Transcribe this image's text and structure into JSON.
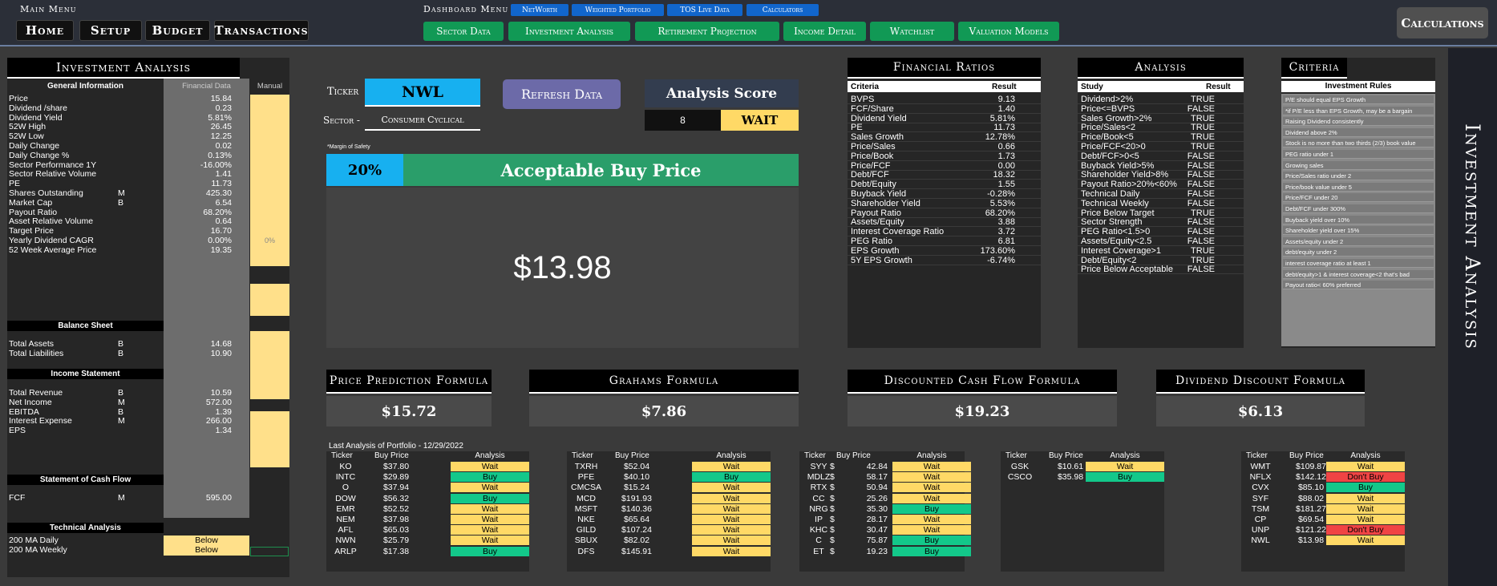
{
  "main_menu": {
    "title": "Main Menu",
    "items": [
      "Home",
      "Setup",
      "Budget",
      "Transactions"
    ]
  },
  "dashboard_menu": {
    "title": "Dashboard Menu",
    "top_items": [
      "NetWorth",
      "Weighted Portfolio",
      "TOS Live Data",
      "Calculators"
    ],
    "bottom_items": [
      "Sector Data",
      "Investment Analysis",
      "Retirement Projection",
      "Income Detail",
      "Watchlist",
      "Valuation Models"
    ]
  },
  "calculations_button": "Calculations",
  "side_title": "Investment Analysis",
  "info_panel": {
    "title": "Investment Analysis",
    "col_general": "General Information",
    "col_financial": "Financial Data",
    "col_manual": "Manual",
    "general": [
      {
        "label": "Price",
        "unit": "",
        "value": "15.84",
        "manual": ""
      },
      {
        "label": "Dividend /share",
        "unit": "",
        "value": "0.23",
        "manual": ""
      },
      {
        "label": "Dividend Yield",
        "unit": "",
        "value": "5.81%",
        "manual": ""
      },
      {
        "label": "52W High",
        "unit": "",
        "value": "26.45",
        "manual": ""
      },
      {
        "label": "52W Low",
        "unit": "",
        "value": "12.25",
        "manual": ""
      },
      {
        "label": "Daily Change",
        "unit": "",
        "value": "0.02",
        "manual": ""
      },
      {
        "label": "Daily Change %",
        "unit": "",
        "value": "0.13%",
        "manual": ""
      },
      {
        "label": "Sector Performance 1Y",
        "unit": "",
        "value": "-16.00%",
        "manual": ""
      },
      {
        "label": "Sector Relative Volume",
        "unit": "",
        "value": "1.41",
        "manual": ""
      },
      {
        "label": "PE",
        "unit": "",
        "value": "11.73",
        "manual": ""
      },
      {
        "label": "Shares Outstanding",
        "unit": "M",
        "value": "425.30",
        "manual": ""
      },
      {
        "label": "Market Cap",
        "unit": "B",
        "value": "6.54",
        "manual": ""
      },
      {
        "label": "Payout Ratio",
        "unit": "",
        "value": "68.20%",
        "manual": ""
      },
      {
        "label": "Asset Relative Volume",
        "unit": "",
        "value": "0.64",
        "manual": ""
      },
      {
        "label": "Target Price",
        "unit": "",
        "value": "16.70",
        "manual": ""
      },
      {
        "label": "Yearly Dividend CAGR",
        "unit": "",
        "value": "0.00%",
        "manual": "0%"
      },
      {
        "label": "52 Week Average Price",
        "unit": "",
        "value": "19.35",
        "manual": ""
      }
    ],
    "balance_title": "Balance Sheet",
    "balance": [
      {
        "label": "Total Assets",
        "unit": "B",
        "value": "14.68"
      },
      {
        "label": "Total Liabilities",
        "unit": "B",
        "value": "10.90"
      }
    ],
    "income_title": "Income Statement",
    "income": [
      {
        "label": "Total Revenue",
        "unit": "B",
        "value": "10.59"
      },
      {
        "label": "Net Income",
        "unit": "M",
        "value": "572.00"
      },
      {
        "label": "EBITDA",
        "unit": "B",
        "value": "1.39"
      },
      {
        "label": "Interest Expense",
        "unit": "M",
        "value": "266.00"
      },
      {
        "label": "EPS",
        "unit": "",
        "value": "1.34"
      }
    ],
    "cashflow_title": "Statement of Cash Flow",
    "cashflow": [
      {
        "label": "FCF",
        "unit": "M",
        "value": "595.00"
      }
    ],
    "technical_title": "Technical Analysis",
    "technical": [
      {
        "label": "200 MA Daily",
        "value": "Below"
      },
      {
        "label": "200 MA Weekly",
        "value": "Below"
      }
    ]
  },
  "ticker": {
    "label": "Ticker",
    "value": "NWL"
  },
  "sector": {
    "label": "Sector -",
    "value": "Consumer Cyclical"
  },
  "refresh_button": "Refresh Data",
  "score": {
    "title": "Analysis Score",
    "value": "8",
    "verdict": "WAIT"
  },
  "margin": {
    "note": "*Margin of Safety",
    "value": "20%",
    "label": "Acceptable Buy Price",
    "price": "$13.98"
  },
  "ratios": {
    "title": "Financial Ratios",
    "col1": "Criteria",
    "col2": "Result",
    "rows": [
      [
        "BVPS",
        "9.13"
      ],
      [
        "FCF/Share",
        "1.40"
      ],
      [
        "Dividend Yield",
        "5.81%"
      ],
      [
        "PE",
        "11.73"
      ],
      [
        "Sales Growth",
        "12.78%"
      ],
      [
        "Price/Sales",
        "0.66"
      ],
      [
        "Price/Book",
        "1.73"
      ],
      [
        "Price/FCF",
        "0.00"
      ],
      [
        "Debt/FCF",
        "18.32"
      ],
      [
        "Debt/Equity",
        "1.55"
      ],
      [
        "Buyback Yield",
        "-0.28%"
      ],
      [
        "Shareholder Yield",
        "5.53%"
      ],
      [
        "Payout Ratio",
        "68.20%"
      ],
      [
        "Assets/Equity",
        "3.88"
      ],
      [
        "Interest Coverage Ratio",
        "3.72"
      ],
      [
        "PEG Ratio",
        "6.81"
      ],
      [
        "EPS Growth",
        "173.60%"
      ],
      [
        "5Y EPS Growth",
        "-6.74%"
      ]
    ]
  },
  "analysis": {
    "title": "Analysis",
    "col1": "Study",
    "col2": "Result",
    "rows": [
      [
        "Dividend>2%",
        "TRUE"
      ],
      [
        "Price<=BVPS",
        "FALSE"
      ],
      [
        "Sales Growth>2%",
        "TRUE"
      ],
      [
        "Price/Sales<2",
        "TRUE"
      ],
      [
        "Price/Book<5",
        "TRUE"
      ],
      [
        "Price/FCF<20>0",
        "TRUE"
      ],
      [
        "Debt/FCF>0<5",
        "FALSE"
      ],
      [
        "Buyback Yield>5%",
        "FALSE"
      ],
      [
        "Shareholder Yield>8%",
        "FALSE"
      ],
      [
        "Payout Ratio>20%<60%",
        "FALSE"
      ],
      [
        "Technical Daily",
        "FALSE"
      ],
      [
        "Technical Weekly",
        "FALSE"
      ],
      [
        "Price Below Target",
        "TRUE"
      ],
      [
        "Sector Strength",
        "FALSE"
      ],
      [
        "PEG Ratio<1.5>0",
        "FALSE"
      ],
      [
        "Assets/Equity<2.5",
        "FALSE"
      ],
      [
        "Interest Coverage>1",
        "TRUE"
      ],
      [
        "Debt/Equity<2",
        "TRUE"
      ],
      [
        "Price Below Acceptable",
        "FALSE"
      ]
    ]
  },
  "criteria": {
    "title": "Criteria",
    "col": "Investment Rules",
    "rows": [
      "P/E should equal EPS Growth",
      "*if P/E less than EPS Growth, may be a bargain",
      "Raising Dividend consistently",
      "Dividend above 2%",
      "Stock is no more than two thirds (2/3) book value",
      "PEG ratio under 1",
      "Growing sales",
      "Price/Sales ratio under 2",
      "Price/book value under 5",
      "Price/FCF under 20",
      "Debt/FCF under 300%",
      "Buyback yield over 10%",
      "Shareholder yield over 15%",
      "Assets/equity under 2",
      "debt/equity under 2",
      "interest coverage ratio at least 1",
      "debt/equity>1 & interest coverage<2 that's bad",
      "Payout ratio< 60% preferred"
    ]
  },
  "formulas": [
    {
      "title": "Price Prediction Formula",
      "value": "$15.72"
    },
    {
      "title": "Grahams Formula",
      "value": "$7.86"
    },
    {
      "title": "Discounted Cash Flow Formula",
      "value": "$19.23"
    },
    {
      "title": "Dividend Discount Formula",
      "value": "$6.13"
    }
  ],
  "portfolio": {
    "title": "Last Analysis of Portfolio - 12/29/2022",
    "headers": [
      "Ticker",
      "Buy Price",
      "Analysis"
    ],
    "tables": [
      [
        [
          "KO",
          "$37.80",
          "Wait"
        ],
        [
          "INTC",
          "$29.89",
          "Buy"
        ],
        [
          "O",
          "$37.94",
          "Wait"
        ],
        [
          "DOW",
          "$56.32",
          "Buy"
        ],
        [
          "EMR",
          "$52.52",
          "Wait"
        ],
        [
          "NEM",
          "$37.98",
          "Wait"
        ],
        [
          "AFL",
          "$65.03",
          "Wait"
        ],
        [
          "NWN",
          "$25.79",
          "Wait"
        ],
        [
          "ARLP",
          "$17.38",
          "Buy"
        ]
      ],
      [
        [
          "TXRH",
          "$52.04",
          "Wait"
        ],
        [
          "PFE",
          "$40.10",
          "Buy"
        ],
        [
          "CMCSA",
          "$15.24",
          "Wait"
        ],
        [
          "MCD",
          "$191.93",
          "Wait"
        ],
        [
          "MSFT",
          "$140.36",
          "Wait"
        ],
        [
          "NKE",
          "$65.64",
          "Wait"
        ],
        [
          "GILD",
          "$107.24",
          "Wait"
        ],
        [
          "SBUX",
          "$82.02",
          "Wait"
        ],
        [
          "DFS",
          "$145.91",
          "Wait"
        ]
      ],
      [
        [
          "SYY",
          "$",
          "42.84",
          "Wait"
        ],
        [
          "MDLZ",
          "$",
          "58.17",
          "Wait"
        ],
        [
          "RTX",
          "$",
          "50.94",
          "Wait"
        ],
        [
          "CC",
          "$",
          "25.26",
          "Wait"
        ],
        [
          "NRG",
          "$",
          "35.30",
          "Buy"
        ],
        [
          "IP",
          "$",
          "28.17",
          "Wait"
        ],
        [
          "KHC",
          "$",
          "30.47",
          "Wait"
        ],
        [
          "C",
          "$",
          "75.87",
          "Buy"
        ],
        [
          "ET",
          "$",
          "19.23",
          "Buy"
        ]
      ],
      [
        [
          "GSK",
          "$10.61",
          "Wait"
        ],
        [
          "CSCO",
          "$35.98",
          "Buy"
        ]
      ],
      [
        [
          "WMT",
          "$109.87",
          "Wait"
        ],
        [
          "NFLX",
          "$142.12",
          "Don't Buy"
        ],
        [
          "CVX",
          "$85.10",
          "Buy"
        ],
        [
          "SYF",
          "$88.02",
          "Wait"
        ],
        [
          "TSM",
          "$181.27",
          "Wait"
        ],
        [
          "CP",
          "$69.54",
          "Wait"
        ],
        [
          "UNP",
          "$121.22",
          "Don't Buy"
        ],
        [
          "NWL",
          "$13.98",
          "Wait"
        ]
      ]
    ]
  },
  "colors": {
    "wait": "#ffd966",
    "buy": "#13c88a",
    "dont": "#f04444",
    "accent": "#1166cc",
    "green": "#119955"
  }
}
